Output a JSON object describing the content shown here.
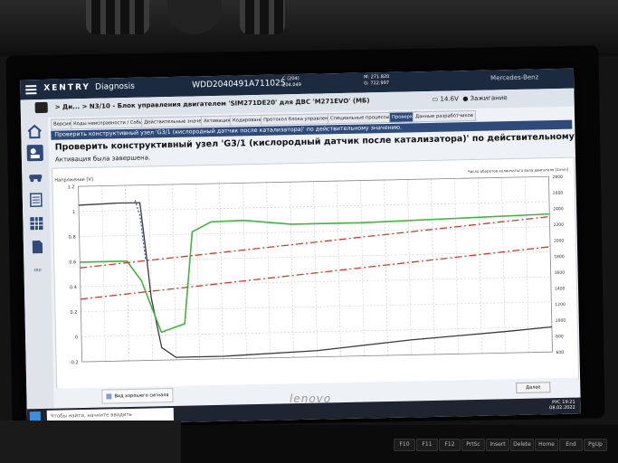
{
  "app": {
    "name": "XENTRY",
    "subtitle": "Diagnosis",
    "vin": "WDD2040491A711025",
    "code_c_line1": "C (204)",
    "code_c_line2": "204.049",
    "code_m_line1": "M: 271.820",
    "code_m_line2": "G: 722.997",
    "brand": "Mercedes-Benz"
  },
  "breadcrumb": {
    "text": "> Ди... > N3/10 - Блок управления двигателем 'SIM271DE20' для ДВС 'M271EVO' (МБ)",
    "battery": "14.6V",
    "ignition": "Зажигание"
  },
  "tabs": [
    "Версия",
    "Коды неисправности / События",
    "Действительные значения",
    "Активация",
    "Кодирование",
    "Протокол блока управления",
    "Специальные процессы",
    "Проверки",
    "Данные разработчиков"
  ],
  "active_tab": "Проверки",
  "blue_bar": "Проверить конструктивный узел 'G3/1 (кислородный датчик после катализатора)' по действительному значению.",
  "main": {
    "title": "Проверить конструктивный узел 'G3/1 (кислородный датчик после катализатора)' по действительному значению.",
    "status": "Активация была завершена."
  },
  "legend_label": "Вид хорошего сигнала",
  "next_button": "Далее",
  "taskbar": {
    "search_placeholder": "Чтобы найти, начните вводить",
    "time": "19:21",
    "date": "08.02.2022",
    "lang": "РУС"
  },
  "laptop_brand": "lenovo",
  "keys": [
    "F10",
    "F11",
    "F12",
    "PrtSc",
    "Insert",
    "Delete",
    "Home",
    "End",
    "PgUp"
  ],
  "colors": {
    "header": "#1b2a3f",
    "blue_bar": "#2d4a7a",
    "voltage_series": "#3a3a3a",
    "rpm_series": "#3cb83c",
    "threshold_series": "#d03a2a"
  },
  "chart_data": {
    "type": "line",
    "ylabel_left": "Напряжение [V]",
    "ylabel_right": "Число оборотов коленчатого вала двигателя [1/min]",
    "y_left_ticks": [
      "1.2",
      "1",
      "0.8",
      "0.6",
      "0.4",
      "0.2",
      "0",
      "-0.2"
    ],
    "y_left_range": [
      -0.2,
      1.2
    ],
    "y_right_ticks": [
      "2800",
      "2600",
      "2400",
      "2200",
      "2000",
      "1800",
      "1600",
      "1400",
      "1200",
      "1000",
      "800",
      "600"
    ],
    "y_right_range": [
      600,
      2800
    ],
    "x_range": [
      0,
      100
    ],
    "grid": true,
    "series": [
      {
        "axis": "left",
        "style": "solid",
        "x": [
          0,
          8,
          13,
          14,
          15,
          17,
          20,
          30,
          50,
          70,
          90,
          100
        ],
        "values": [
          1.05,
          1.06,
          1.06,
          0.7,
          0.3,
          -0.1,
          -0.18,
          -0.18,
          -0.15,
          -0.08,
          -0.03,
          0.0
        ]
      },
      {
        "axis": "left",
        "style": "dash",
        "x": [
          12,
          13,
          14
        ],
        "values": [
          1.08,
          0.95,
          0.6
        ]
      },
      {
        "axis": "right",
        "style": "solid",
        "x": [
          0,
          10,
          13,
          17,
          22,
          24,
          28,
          35,
          45,
          60,
          80,
          100
        ],
        "values": [
          1850,
          1850,
          1600,
          950,
          1050,
          2200,
          2320,
          2330,
          2270,
          2270,
          2300,
          2330
        ]
      },
      {
        "axis": "left",
        "style": "dashdot",
        "x": [
          0,
          100
        ],
        "values": [
          0.55,
          0.88
        ]
      },
      {
        "axis": "left",
        "style": "dashdot",
        "x": [
          0,
          100
        ],
        "values": [
          0.3,
          0.64
        ]
      }
    ]
  }
}
